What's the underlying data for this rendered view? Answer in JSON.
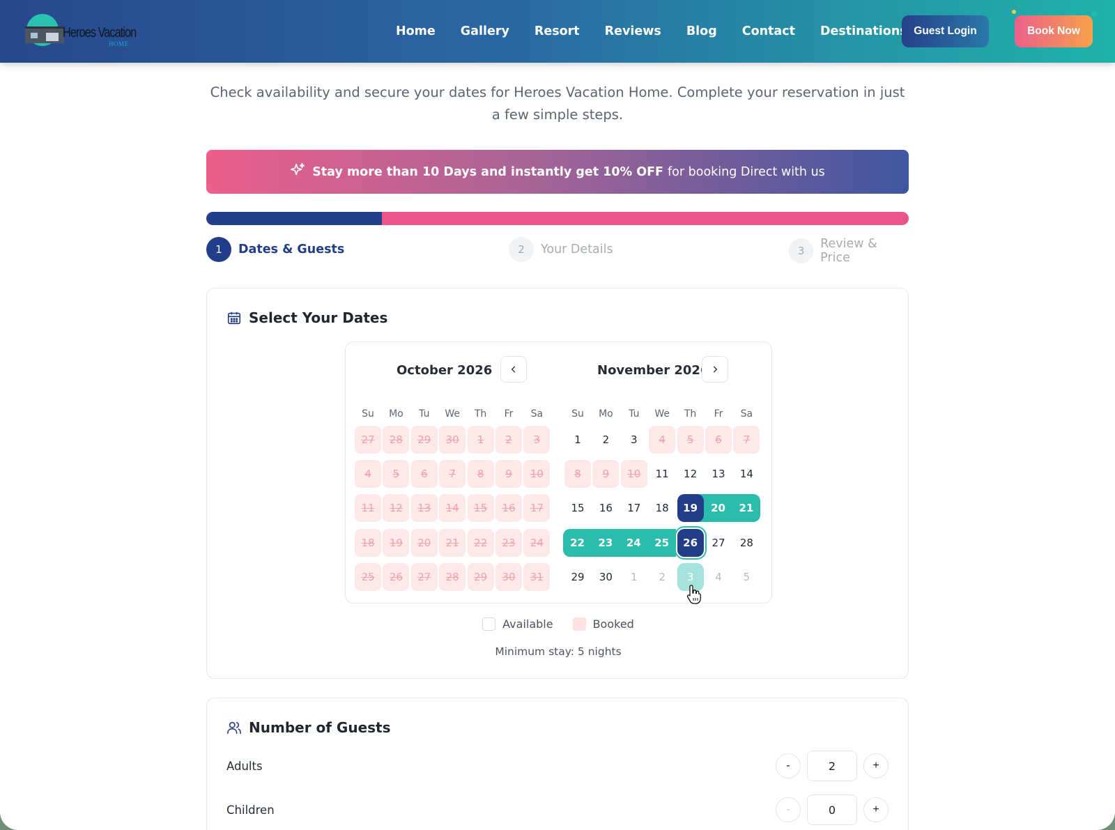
{
  "header": {
    "logo_text": "Heroes Vacation",
    "logo_sub": "HOME",
    "nav": [
      "Home",
      "Gallery",
      "Resort",
      "Reviews",
      "Blog",
      "Contact",
      "Destinations"
    ],
    "guest_login": "Guest Login",
    "book_now": "Book Now"
  },
  "intro": "Check availability and secure your dates for Heroes Vacation Home. Complete your reservation in just a few simple steps.",
  "promo": {
    "bold": "Stay more than 10 Days and instantly get 10% OFF",
    "rest": "for booking Direct with us"
  },
  "progress": {
    "fraction": 0.25
  },
  "steps": [
    {
      "num": "1",
      "label": "Dates & Guests",
      "active": true
    },
    {
      "num": "2",
      "label": "Your Details",
      "active": false
    },
    {
      "num": "3",
      "label": "Review & Price",
      "active": false
    }
  ],
  "dates_card": {
    "title": "Select Your Dates",
    "weekdays": [
      "Su",
      "Mo",
      "Tu",
      "We",
      "Th",
      "Fr",
      "Sa"
    ],
    "months": [
      {
        "title": "October 2026",
        "weeks": [
          [
            {
              "d": "27",
              "s": "booked"
            },
            {
              "d": "28",
              "s": "booked"
            },
            {
              "d": "29",
              "s": "booked"
            },
            {
              "d": "30",
              "s": "booked"
            },
            {
              "d": "1",
              "s": "booked"
            },
            {
              "d": "2",
              "s": "booked"
            },
            {
              "d": "3",
              "s": "booked"
            }
          ],
          [
            {
              "d": "4",
              "s": "booked"
            },
            {
              "d": "5",
              "s": "booked"
            },
            {
              "d": "6",
              "s": "booked"
            },
            {
              "d": "7",
              "s": "booked"
            },
            {
              "d": "8",
              "s": "booked"
            },
            {
              "d": "9",
              "s": "booked"
            },
            {
              "d": "10",
              "s": "booked"
            }
          ],
          [
            {
              "d": "11",
              "s": "booked"
            },
            {
              "d": "12",
              "s": "booked"
            },
            {
              "d": "13",
              "s": "booked"
            },
            {
              "d": "14",
              "s": "booked"
            },
            {
              "d": "15",
              "s": "booked"
            },
            {
              "d": "16",
              "s": "booked"
            },
            {
              "d": "17",
              "s": "booked"
            }
          ],
          [
            {
              "d": "18",
              "s": "booked"
            },
            {
              "d": "19",
              "s": "booked"
            },
            {
              "d": "20",
              "s": "booked"
            },
            {
              "d": "21",
              "s": "booked"
            },
            {
              "d": "22",
              "s": "booked"
            },
            {
              "d": "23",
              "s": "booked"
            },
            {
              "d": "24",
              "s": "booked"
            }
          ],
          [
            {
              "d": "25",
              "s": "booked"
            },
            {
              "d": "26",
              "s": "booked"
            },
            {
              "d": "27",
              "s": "booked"
            },
            {
              "d": "28",
              "s": "booked"
            },
            {
              "d": "29",
              "s": "booked"
            },
            {
              "d": "30",
              "s": "booked"
            },
            {
              "d": "31",
              "s": "booked"
            }
          ]
        ]
      },
      {
        "title": "November 2026",
        "weeks": [
          [
            {
              "d": "1",
              "s": "available"
            },
            {
              "d": "2",
              "s": "available"
            },
            {
              "d": "3",
              "s": "available"
            },
            {
              "d": "4",
              "s": "booked"
            },
            {
              "d": "5",
              "s": "booked"
            },
            {
              "d": "6",
              "s": "booked"
            },
            {
              "d": "7",
              "s": "booked"
            }
          ],
          [
            {
              "d": "8",
              "s": "booked"
            },
            {
              "d": "9",
              "s": "booked"
            },
            {
              "d": "10",
              "s": "booked"
            },
            {
              "d": "11",
              "s": "available"
            },
            {
              "d": "12",
              "s": "available"
            },
            {
              "d": "13",
              "s": "available"
            },
            {
              "d": "14",
              "s": "available"
            }
          ],
          [
            {
              "d": "15",
              "s": "available"
            },
            {
              "d": "16",
              "s": "available"
            },
            {
              "d": "17",
              "s": "available"
            },
            {
              "d": "18",
              "s": "available"
            },
            {
              "d": "19",
              "s": "range-start"
            },
            {
              "d": "20",
              "s": "range"
            },
            {
              "d": "21",
              "s": "range"
            }
          ],
          [
            {
              "d": "22",
              "s": "range"
            },
            {
              "d": "23",
              "s": "range"
            },
            {
              "d": "24",
              "s": "range"
            },
            {
              "d": "25",
              "s": "range"
            },
            {
              "d": "26",
              "s": "range-end"
            },
            {
              "d": "27",
              "s": "available"
            },
            {
              "d": "28",
              "s": "available"
            }
          ],
          [
            {
              "d": "29",
              "s": "available"
            },
            {
              "d": "30",
              "s": "available"
            },
            {
              "d": "1",
              "s": "muted"
            },
            {
              "d": "2",
              "s": "muted"
            },
            {
              "d": "3",
              "s": "hover"
            },
            {
              "d": "4",
              "s": "muted"
            },
            {
              "d": "5",
              "s": "muted"
            }
          ]
        ]
      }
    ],
    "legend": {
      "available": "Available",
      "booked": "Booked"
    },
    "min_stay": "Minimum stay: 5 nights"
  },
  "guests_card": {
    "title": "Number of Guests",
    "rows": [
      {
        "label": "Adults",
        "value": "2",
        "minus": "-",
        "plus": "+",
        "minus_disabled": false
      },
      {
        "label": "Children",
        "value": "0",
        "minus": "-",
        "plus": "+",
        "minus_disabled": true
      }
    ]
  },
  "colors": {
    "primary": "#233d88",
    "accent": "#2bbcab",
    "pink": "#ea5488",
    "booked_bg": "#fde9ea"
  }
}
